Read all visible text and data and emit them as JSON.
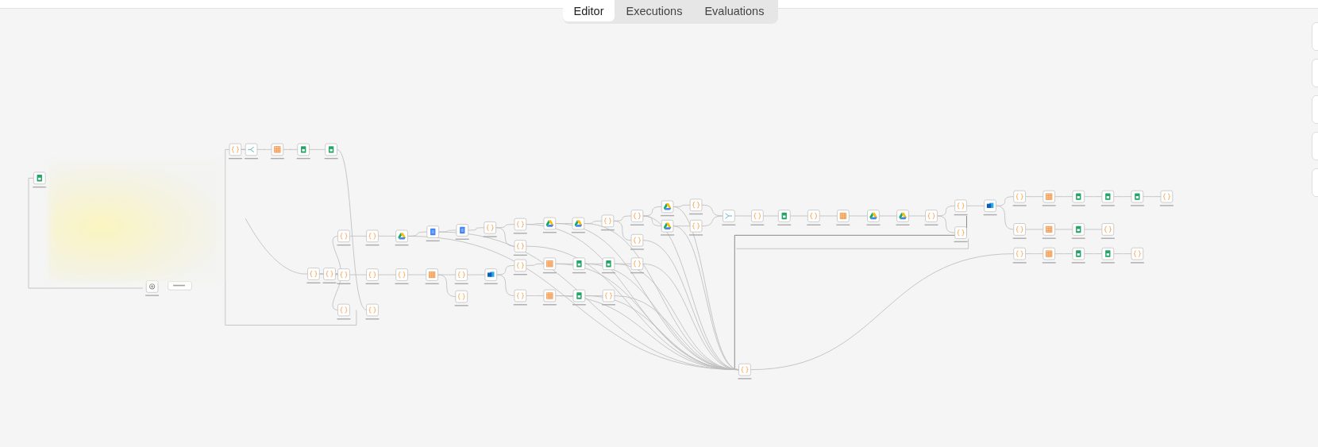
{
  "tabs": [
    {
      "label": "Editor",
      "selected": true
    },
    {
      "label": "Executions",
      "selected": false
    },
    {
      "label": "Evaluations",
      "selected": false
    }
  ]
}
